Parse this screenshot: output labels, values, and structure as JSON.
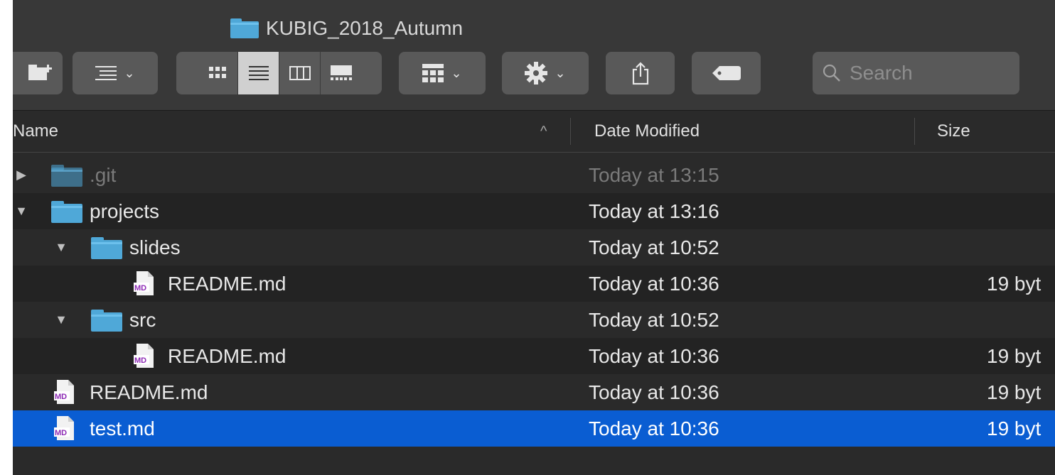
{
  "window": {
    "title": "KUBIG_2018_Autumn"
  },
  "toolbar": {
    "search_placeholder": "Search",
    "icons": [
      "new-folder-icon",
      "list-options-icon",
      "icon-view-icon",
      "list-view-icon",
      "column-view-icon",
      "gallery-view-icon",
      "group-icon",
      "gear-icon",
      "share-icon",
      "tag-icon",
      "search-icon"
    ]
  },
  "columns": {
    "name": "Name",
    "date": "Date Modified",
    "size": "Size"
  },
  "rows": [
    {
      "name": ".git",
      "date": "Today at 13:15",
      "size": "",
      "kind": "folder",
      "expanded": false,
      "level": 0,
      "dim": true
    },
    {
      "name": "projects",
      "date": "Today at 13:16",
      "size": "",
      "kind": "folder",
      "expanded": true,
      "level": 0
    },
    {
      "name": "slides",
      "date": "Today at 10:52",
      "size": "",
      "kind": "folder",
      "expanded": true,
      "level": 1
    },
    {
      "name": "README.md",
      "date": "Today at 10:36",
      "size": "19 byt",
      "kind": "md",
      "level": 2
    },
    {
      "name": "src",
      "date": "Today at 10:52",
      "size": "",
      "kind": "folder",
      "expanded": true,
      "level": 1
    },
    {
      "name": "README.md",
      "date": "Today at 10:36",
      "size": "19 byt",
      "kind": "md",
      "level": 2
    },
    {
      "name": "README.md",
      "date": "Today at 10:36",
      "size": "19 byt",
      "kind": "md",
      "level": 0
    },
    {
      "name": "test.md",
      "date": "Today at 10:36",
      "size": "19 byt",
      "kind": "md",
      "level": 0,
      "selected": true
    }
  ],
  "colors": {
    "selection": "#0a5dd2",
    "folder": "#4fa8d8"
  }
}
